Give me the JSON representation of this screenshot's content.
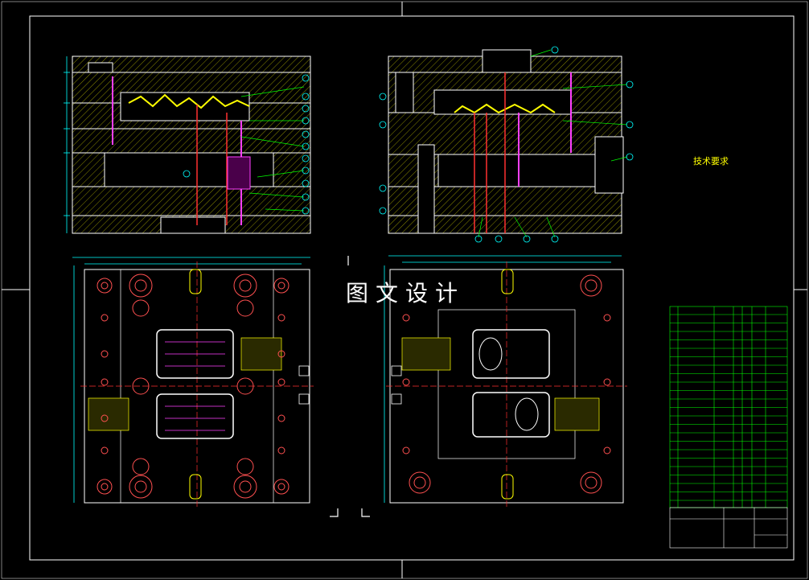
{
  "watermark": "图文设计",
  "technical_requirements": {
    "title": "技术要求"
  },
  "colors": {
    "background": "#000000",
    "frame": "#ffffff",
    "outline": "#ffffff",
    "hatch": "#b0b000",
    "part": "#ffff00",
    "dimension": "#00ffff",
    "center_line": "#ff3030",
    "pin": "#ff40ff",
    "leader": "#00ff00"
  },
  "icons": [
    "balloon-marker-icon",
    "corner-mark-icon"
  ]
}
